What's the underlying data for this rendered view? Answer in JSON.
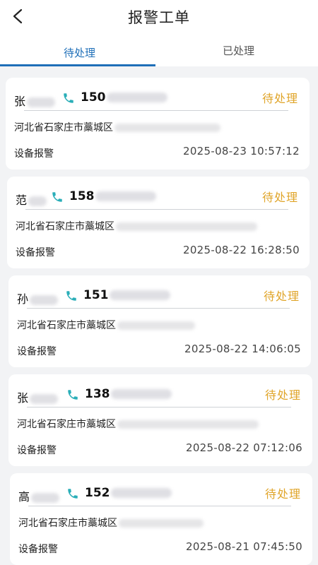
{
  "header": {
    "title": "报警工单",
    "back_icon": "chevron-left-icon"
  },
  "tabs": [
    {
      "label": "待处理",
      "active": true
    },
    {
      "label": "已处理",
      "active": false
    }
  ],
  "colors": {
    "accent": "#1f6fb8",
    "status_pending": "#e0a52a",
    "phone_icon": "#2aaeb8",
    "background": "#f2f3f5"
  },
  "orders": [
    {
      "surname": "张",
      "phone_prefix": "150",
      "status": "待处理",
      "address": "河北省石家庄市藁城区",
      "type": "设备报警",
      "time": "2025-08-23 10:57:12"
    },
    {
      "surname": "范",
      "phone_prefix": "158",
      "status": "待处理",
      "address": "河北省石家庄市藁城区",
      "type": "设备报警",
      "time": "2025-08-22 16:28:50"
    },
    {
      "surname": "孙",
      "phone_prefix": "151",
      "status": "待处理",
      "address": "河北省石家庄市藁城区",
      "type": "设备报警",
      "time": "2025-08-22 14:06:05"
    },
    {
      "surname": "张",
      "phone_prefix": "138",
      "status": "待处理",
      "address": "河北省石家庄市藁城区",
      "type": "设备报警",
      "time": "2025-08-22 07:12:06"
    },
    {
      "surname": "高",
      "phone_prefix": "152",
      "status": "待处理",
      "address": "河北省石家庄市藁城区",
      "type": "设备报警",
      "time": "2025-08-21 07:45:50"
    }
  ]
}
